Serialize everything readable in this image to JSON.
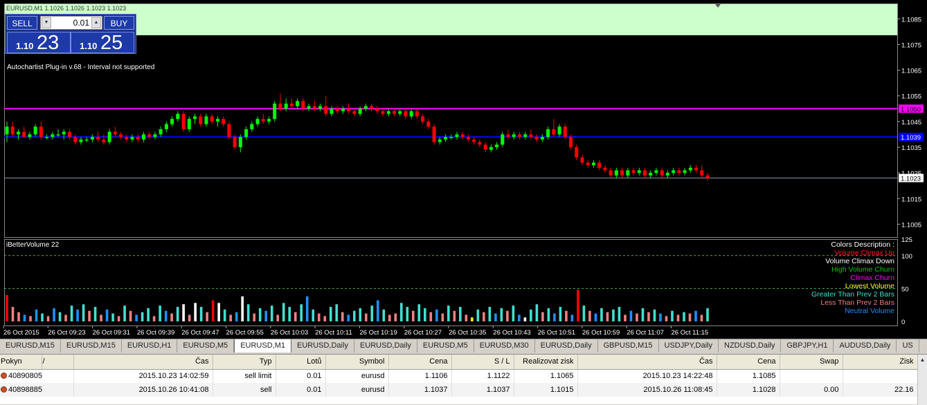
{
  "window": {
    "title": "EURUSD,M1  1.1026 1.1026 1.1023 1.1023"
  },
  "one_click": {
    "sell_label": "SELL",
    "buy_label": "BUY",
    "lot_value": "0.01",
    "sell_price_prefix": "1.10",
    "sell_price_main": "23",
    "buy_price_prefix": "1.10",
    "buy_price_main": "25"
  },
  "plugin_text": "Autochartist Plug-in v.68 - Interval not supported",
  "price_axis": {
    "ticks": [
      "1.1085",
      "1.1075",
      "1.1065",
      "1.1055",
      "1.1045",
      "1.1035",
      "1.1025",
      "1.1015",
      "1.1005"
    ],
    "labels": {
      "magenta_line": "1.1050",
      "blue_line": "1.1039",
      "current": "1.1023"
    }
  },
  "colors": {
    "bull": "#00ff00",
    "bear": "#ff0000",
    "magenta_line": "#ff00ff",
    "blue_line": "#0000ff",
    "header_green": "#ccffcc",
    "one_click_blue": "#1d3aa8"
  },
  "volume": {
    "title": "iBetterVolume 22",
    "axis_ticks": [
      "125",
      "100",
      "50",
      "0"
    ],
    "legend_title": "Colors Description :",
    "legend": [
      {
        "label": "Volume Climax Up",
        "color": "#ff0000"
      },
      {
        "label": "Volume Climax Down",
        "color": "#ffffff"
      },
      {
        "label": "High Volume Churn",
        "color": "#00cc00"
      },
      {
        "label": "Climax Churn",
        "color": "#ff00ff"
      },
      {
        "label": "Lowest Volume",
        "color": "#ffff00"
      },
      {
        "label": "Greater Than Prev 2 Bars",
        "color": "#40e0d0"
      },
      {
        "label": "Less Than Prev 2 Bars",
        "color": "#f08080"
      },
      {
        "label": "Neutral Volume",
        "color": "#1e90ff"
      }
    ]
  },
  "time_axis": [
    "26 Oct 2015",
    "26 Oct 09:23",
    "26 Oct 09:31",
    "26 Oct 09:39",
    "26 Oct 09:47",
    "26 Oct 09:55",
    "26 Oct 10:03",
    "26 Oct 10:11",
    "26 Oct 10:19",
    "26 Oct 10:27",
    "26 Oct 10:35",
    "26 Oct 10:43",
    "26 Oct 10:51",
    "26 Oct 10:59",
    "26 Oct 11:07",
    "26 Oct 11:15"
  ],
  "tabs": [
    "EURUSD,M15",
    "EURUSD,M15",
    "EURUSD,H1",
    "EURUSD,M5",
    "EURUSD,M1",
    "EURUSD,Daily",
    "EURUSD,Daily",
    "EURUSD,M5",
    "EURUSD,M30",
    "EURUSD,Daily",
    "GBPUSD,M15",
    "USDJPY,Daily",
    "NZDUSD,Daily",
    "GBPJPY,H1",
    "AUDUSD,Daily",
    "US"
  ],
  "active_tab": 4,
  "terminal": {
    "columns": [
      "Pokyn",
      "/",
      "Čas",
      "Typ",
      "Lotů",
      "Symbol",
      "Cena",
      "S / L",
      "Realizovat zisk",
      "Čas",
      "Cena",
      "Swap",
      "Zisk"
    ],
    "rows": [
      [
        "40890805",
        "2015.10.23 14:02:59",
        "sell limit",
        "0.01",
        "eurusd",
        "1.1106",
        "1.1122",
        "1.1065",
        "2015.10.23 14:22:48",
        "1.1085",
        "",
        ""
      ],
      [
        "40898885",
        "2015.10.26 10:41:08",
        "sell",
        "0.01",
        "eurusd",
        "1.1037",
        "1.1037",
        "1.1015",
        "2015.10.26 11:08:45",
        "1.1028",
        "0.00",
        "22.16"
      ]
    ]
  },
  "chart_data": [
    {
      "type": "candlestick",
      "title": "EURUSD,M1",
      "xlabel": "",
      "ylabel": "",
      "ylim": [
        1.1,
        1.1091
      ],
      "ticks": [
        1.1085,
        1.1075,
        1.1065,
        1.1055,
        1.1045,
        1.1035,
        1.1025,
        1.1015,
        1.1005
      ],
      "hlines": [
        {
          "value": 1.105,
          "color": "#ff00ff"
        },
        {
          "value": 1.1039,
          "color": "#0000ff"
        },
        {
          "value": 1.1023,
          "color": "#8899aa"
        }
      ],
      "ohlc": [
        [
          1.104,
          1.1045,
          1.1037,
          1.1043
        ],
        [
          1.1043,
          1.1045,
          1.1039,
          1.104
        ],
        [
          1.104,
          1.1042,
          1.1038,
          1.1041
        ],
        [
          1.1041,
          1.1043,
          1.1039,
          1.1039
        ],
        [
          1.1039,
          1.1041,
          1.1038,
          1.104
        ],
        [
          1.104,
          1.1044,
          1.1039,
          1.1043
        ],
        [
          1.1043,
          1.1045,
          1.1038,
          1.1039
        ],
        [
          1.1039,
          1.104,
          1.1038,
          1.1039
        ],
        [
          1.1039,
          1.1041,
          1.1038,
          1.104
        ],
        [
          1.104,
          1.1042,
          1.1039,
          1.104
        ],
        [
          1.104,
          1.1042,
          1.1038,
          1.1041
        ],
        [
          1.1041,
          1.1042,
          1.1038,
          1.1039
        ],
        [
          1.1039,
          1.104,
          1.1036,
          1.1037
        ],
        [
          1.1037,
          1.1039,
          1.1036,
          1.1038
        ],
        [
          1.1038,
          1.1039,
          1.1037,
          1.1038
        ],
        [
          1.1038,
          1.104,
          1.1037,
          1.1039
        ],
        [
          1.1039,
          1.1041,
          1.1037,
          1.1038
        ],
        [
          1.1038,
          1.104,
          1.1036,
          1.1037
        ],
        [
          1.1037,
          1.1042,
          1.1036,
          1.1041
        ],
        [
          1.1041,
          1.1043,
          1.1039,
          1.104
        ],
        [
          1.104,
          1.1041,
          1.1038,
          1.1039
        ],
        [
          1.1039,
          1.104,
          1.1037,
          1.1038
        ],
        [
          1.1038,
          1.104,
          1.1037,
          1.1039
        ],
        [
          1.1039,
          1.104,
          1.1037,
          1.1038
        ],
        [
          1.1038,
          1.1041,
          1.1037,
          1.104
        ],
        [
          1.104,
          1.1041,
          1.1038,
          1.1039
        ],
        [
          1.1039,
          1.1041,
          1.1038,
          1.104
        ],
        [
          1.104,
          1.1043,
          1.1039,
          1.1042
        ],
        [
          1.1042,
          1.1045,
          1.1041,
          1.1044
        ],
        [
          1.1044,
          1.1047,
          1.1043,
          1.1046
        ],
        [
          1.1046,
          1.1049,
          1.1045,
          1.1048
        ],
        [
          1.1048,
          1.1049,
          1.1041,
          1.1042
        ],
        [
          1.1042,
          1.1047,
          1.1041,
          1.1046
        ],
        [
          1.1046,
          1.1048,
          1.1044,
          1.1047
        ],
        [
          1.1047,
          1.1048,
          1.1043,
          1.1044
        ],
        [
          1.1044,
          1.1048,
          1.1043,
          1.1047
        ],
        [
          1.1047,
          1.1048,
          1.1044,
          1.1045
        ],
        [
          1.1045,
          1.1047,
          1.1043,
          1.1046
        ],
        [
          1.1046,
          1.1047,
          1.1043,
          1.1044
        ],
        [
          1.1044,
          1.1045,
          1.1038,
          1.1039
        ],
        [
          1.1039,
          1.104,
          1.1034,
          1.1035
        ],
        [
          1.1035,
          1.104,
          1.1033,
          1.1039
        ],
        [
          1.1039,
          1.1043,
          1.1038,
          1.1042
        ],
        [
          1.1042,
          1.1045,
          1.1041,
          1.1044
        ],
        [
          1.1044,
          1.1047,
          1.1043,
          1.1046
        ],
        [
          1.1046,
          1.1048,
          1.1044,
          1.1045
        ],
        [
          1.1045,
          1.1047,
          1.1044,
          1.1046
        ],
        [
          1.1046,
          1.1053,
          1.1045,
          1.1052
        ],
        [
          1.1052,
          1.1056,
          1.1049,
          1.105
        ],
        [
          1.105,
          1.1054,
          1.1049,
          1.1052
        ],
        [
          1.1052,
          1.1054,
          1.105,
          1.1051
        ],
        [
          1.1051,
          1.1054,
          1.105,
          1.1053
        ],
        [
          1.1053,
          1.1054,
          1.1049,
          1.105
        ],
        [
          1.105,
          1.1052,
          1.1049,
          1.1051
        ],
        [
          1.1051,
          1.1053,
          1.1049,
          1.105
        ],
        [
          1.105,
          1.1052,
          1.1049,
          1.1051
        ],
        [
          1.1051,
          1.1055,
          1.1047,
          1.1048
        ],
        [
          1.1048,
          1.1051,
          1.1047,
          1.105
        ],
        [
          1.105,
          1.1051,
          1.1048,
          1.1049
        ],
        [
          1.1049,
          1.1051,
          1.1048,
          1.105
        ],
        [
          1.105,
          1.1052,
          1.1048,
          1.1049
        ],
        [
          1.1049,
          1.105,
          1.1047,
          1.1048
        ],
        [
          1.1048,
          1.1051,
          1.1047,
          1.105
        ],
        [
          1.105,
          1.1052,
          1.1049,
          1.1051
        ],
        [
          1.1051,
          1.1052,
          1.1049,
          1.105
        ],
        [
          1.105,
          1.1051,
          1.1048,
          1.1049
        ],
        [
          1.1049,
          1.105,
          1.1047,
          1.1048
        ],
        [
          1.1048,
          1.105,
          1.1047,
          1.1049
        ],
        [
          1.1049,
          1.105,
          1.1047,
          1.1048
        ],
        [
          1.1048,
          1.105,
          1.1047,
          1.1049
        ],
        [
          1.1049,
          1.105,
          1.1046,
          1.1047
        ],
        [
          1.1047,
          1.105,
          1.1046,
          1.1049
        ],
        [
          1.1049,
          1.105,
          1.1046,
          1.1047
        ],
        [
          1.1047,
          1.1048,
          1.1044,
          1.1045
        ],
        [
          1.1045,
          1.1046,
          1.1042,
          1.1043
        ],
        [
          1.1043,
          1.1044,
          1.1036,
          1.1037
        ],
        [
          1.1037,
          1.1039,
          1.1036,
          1.1038
        ],
        [
          1.1038,
          1.104,
          1.1037,
          1.1039
        ],
        [
          1.1039,
          1.104,
          1.1038,
          1.1039
        ],
        [
          1.1039,
          1.1041,
          1.1038,
          1.104
        ],
        [
          1.104,
          1.1041,
          1.1038,
          1.1039
        ],
        [
          1.1039,
          1.104,
          1.1037,
          1.1038
        ],
        [
          1.1038,
          1.1039,
          1.1036,
          1.1037
        ],
        [
          1.1037,
          1.1038,
          1.1035,
          1.1036
        ],
        [
          1.1036,
          1.1037,
          1.1033,
          1.1034
        ],
        [
          1.1034,
          1.1036,
          1.1033,
          1.1035
        ],
        [
          1.1035,
          1.1037,
          1.1034,
          1.1036
        ],
        [
          1.1036,
          1.1041,
          1.1035,
          1.104
        ],
        [
          1.104,
          1.1042,
          1.1038,
          1.1039
        ],
        [
          1.1039,
          1.1041,
          1.1038,
          1.104
        ],
        [
          1.104,
          1.1041,
          1.1038,
          1.1039
        ],
        [
          1.1039,
          1.1041,
          1.1038,
          1.104
        ],
        [
          1.104,
          1.1042,
          1.1038,
          1.1039
        ],
        [
          1.1039,
          1.104,
          1.1037,
          1.1038
        ],
        [
          1.1038,
          1.104,
          1.1037,
          1.1039
        ],
        [
          1.1039,
          1.1043,
          1.1038,
          1.1042
        ],
        [
          1.1042,
          1.1046,
          1.1039,
          1.104
        ],
        [
          1.104,
          1.1044,
          1.1039,
          1.1043
        ],
        [
          1.1043,
          1.1044,
          1.1038,
          1.1039
        ],
        [
          1.1039,
          1.104,
          1.1034,
          1.1035
        ],
        [
          1.1035,
          1.1036,
          1.103,
          1.1031
        ],
        [
          1.1031,
          1.1032,
          1.1028,
          1.1029
        ],
        [
          1.1029,
          1.103,
          1.1027,
          1.1028
        ],
        [
          1.1028,
          1.103,
          1.1027,
          1.1029
        ],
        [
          1.1029,
          1.103,
          1.1026,
          1.1027
        ],
        [
          1.1027,
          1.1028,
          1.1025,
          1.1026
        ],
        [
          1.1026,
          1.1027,
          1.1023,
          1.1024
        ],
        [
          1.1024,
          1.1027,
          1.1023,
          1.1026
        ],
        [
          1.1026,
          1.1027,
          1.1023,
          1.1024
        ],
        [
          1.1024,
          1.1027,
          1.1023,
          1.1026
        ],
        [
          1.1026,
          1.1027,
          1.1024,
          1.1025
        ],
        [
          1.1025,
          1.1027,
          1.1024,
          1.1026
        ],
        [
          1.1026,
          1.1027,
          1.1023,
          1.1024
        ],
        [
          1.1024,
          1.1026,
          1.1023,
          1.1025
        ],
        [
          1.1025,
          1.1027,
          1.1024,
          1.1026
        ],
        [
          1.1026,
          1.1027,
          1.1023,
          1.1024
        ],
        [
          1.1024,
          1.1026,
          1.1023,
          1.1025
        ],
        [
          1.1025,
          1.1027,
          1.1024,
          1.1026
        ],
        [
          1.1026,
          1.1027,
          1.1024,
          1.1025
        ],
        [
          1.1025,
          1.1027,
          1.1024,
          1.1026
        ],
        [
          1.1026,
          1.1028,
          1.1025,
          1.1027
        ],
        [
          1.1027,
          1.1028,
          1.1025,
          1.1026
        ],
        [
          1.1026,
          1.1028,
          1.1023,
          1.1024
        ],
        [
          1.1024,
          1.1025,
          1.1022,
          1.1023
        ]
      ]
    },
    {
      "type": "bar",
      "title": "iBetterVolume 22",
      "xlabel": "",
      "ylabel": "",
      "ylim": [
        0,
        125
      ],
      "levels": [
        100,
        50
      ],
      "values": [
        40,
        22,
        14,
        10,
        8,
        18,
        12,
        8,
        20,
        14,
        10,
        24,
        18,
        26,
        16,
        22,
        10,
        18,
        12,
        8,
        24,
        16,
        10,
        14,
        20,
        8,
        24,
        16,
        12,
        22,
        26,
        10,
        28,
        22,
        14,
        32,
        28,
        18,
        10,
        14,
        38,
        26,
        12,
        20,
        16,
        24,
        10,
        28,
        22,
        14,
        26,
        38,
        18,
        12,
        8,
        22,
        26,
        14,
        10,
        16,
        20,
        12,
        24,
        32,
        18,
        10,
        12,
        28,
        22,
        16,
        26,
        20,
        14,
        18,
        12,
        24,
        16,
        22,
        10,
        6,
        18,
        14,
        22,
        12,
        20,
        16,
        24,
        10,
        6,
        18,
        26,
        14,
        20,
        12,
        22,
        16,
        10,
        48,
        24,
        16,
        12,
        20,
        14,
        18,
        22,
        10,
        16,
        12,
        20,
        14,
        18,
        12,
        8,
        16,
        10,
        14,
        12,
        16,
        10,
        20
      ],
      "colors_idx": [
        0,
        6,
        6,
        7,
        6,
        7,
        5,
        6,
        7,
        5,
        6,
        5,
        7,
        5,
        6,
        5,
        6,
        7,
        5,
        6,
        5,
        6,
        7,
        5,
        5,
        6,
        5,
        7,
        6,
        5,
        1,
        6,
        1,
        5,
        6,
        0,
        1,
        5,
        6,
        7,
        1,
        5,
        6,
        5,
        7,
        5,
        6,
        5,
        5,
        6,
        5,
        7,
        5,
        6,
        6,
        5,
        5,
        6,
        7,
        5,
        5,
        6,
        5,
        7,
        5,
        6,
        6,
        5,
        5,
        6,
        5,
        5,
        6,
        7,
        6,
        5,
        6,
        5,
        6,
        4,
        5,
        6,
        5,
        7,
        5,
        6,
        5,
        7,
        1,
        5,
        5,
        6,
        5,
        7,
        5,
        6,
        7,
        0,
        5,
        6,
        7,
        5,
        6,
        5,
        5,
        6,
        7,
        6,
        5,
        6,
        5,
        7,
        6,
        5,
        6,
        5,
        6,
        7,
        6,
        5
      ]
    }
  ]
}
